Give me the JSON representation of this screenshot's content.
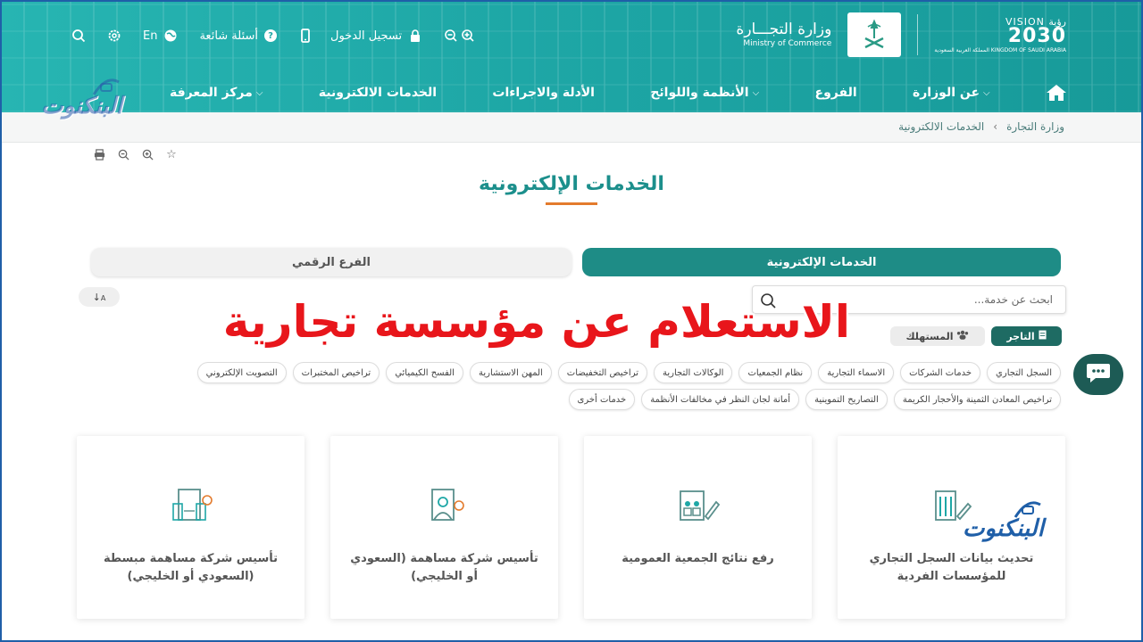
{
  "header": {
    "topbar": {
      "login": "تسجيل الدخول",
      "faq": "أسئلة شائعة",
      "language": "En"
    },
    "vision": {
      "line1": "VISION رؤية",
      "line2": "2030",
      "line3": "المملكة العربية السعودية KINGDOM OF SAUDI ARABIA"
    },
    "ministry": {
      "ar": "وزارة التجـــارة",
      "en": "Ministry of Commerce"
    },
    "nav": [
      {
        "label": "عن الوزارة",
        "dropdown": true
      },
      {
        "label": "الفروع",
        "dropdown": false
      },
      {
        "label": "الأنظمة واللوائح",
        "dropdown": true
      },
      {
        "label": "الأدلة والاجراءات",
        "dropdown": false
      },
      {
        "label": "الخدمات الالكترونية",
        "dropdown": false
      },
      {
        "label": "مركز المعرفة",
        "dropdown": true
      }
    ]
  },
  "breadcrumb": [
    "وزارة التجارة",
    "الخدمات الالكترونية"
  ],
  "page_title": "الخدمات الإلكترونية",
  "tabs": {
    "active": "الخدمات الإلكترونية",
    "inactive": "الفرع الرقمي"
  },
  "search": {
    "placeholder": "ابحث عن خدمة..."
  },
  "audience": {
    "merchant": "التاجر",
    "consumer": "المستهلك"
  },
  "categories_row1": [
    "السجل التجاري",
    "خدمات الشركات",
    "الاسماء التجارية",
    "نظام الجمعيات",
    "الوكالات التجارية",
    "تراخيص التخفيضات",
    "المهن الاستشارية",
    "الفسح الكيميائي",
    "تراخيص المختبرات",
    "التصويت الإلكتروني"
  ],
  "categories_row2": [
    "تراخيص المعادن الثمينة والأحجار الكريمة",
    "التصاريح التموينية",
    "أمانة لجان النظر في مخالفات الأنظمة",
    "خدمات أخرى"
  ],
  "overlay_title": "الاستعلام عن مؤسسة تجارية",
  "watermark": "البنكنوت",
  "cards": [
    {
      "title": "تحديث بيانات السجل التجاري للمؤسسات الفردية",
      "icon": "registry-update-icon"
    },
    {
      "title": "رفع نتائج الجمعية العمومية",
      "icon": "assembly-results-icon"
    },
    {
      "title": "تأسيس شركة مساهمة (السعودي أو الخليجي)",
      "icon": "joint-stock-company-icon"
    },
    {
      "title": "تأسيس شركة مساهمة مبسطة (السعودي أو الخليجي)",
      "icon": "simplified-company-icon"
    }
  ],
  "colors": {
    "brand": "#1ea7a6",
    "active_tab": "#1e8c86",
    "accent": "#e37b2d",
    "overlay": "#e8161b"
  }
}
